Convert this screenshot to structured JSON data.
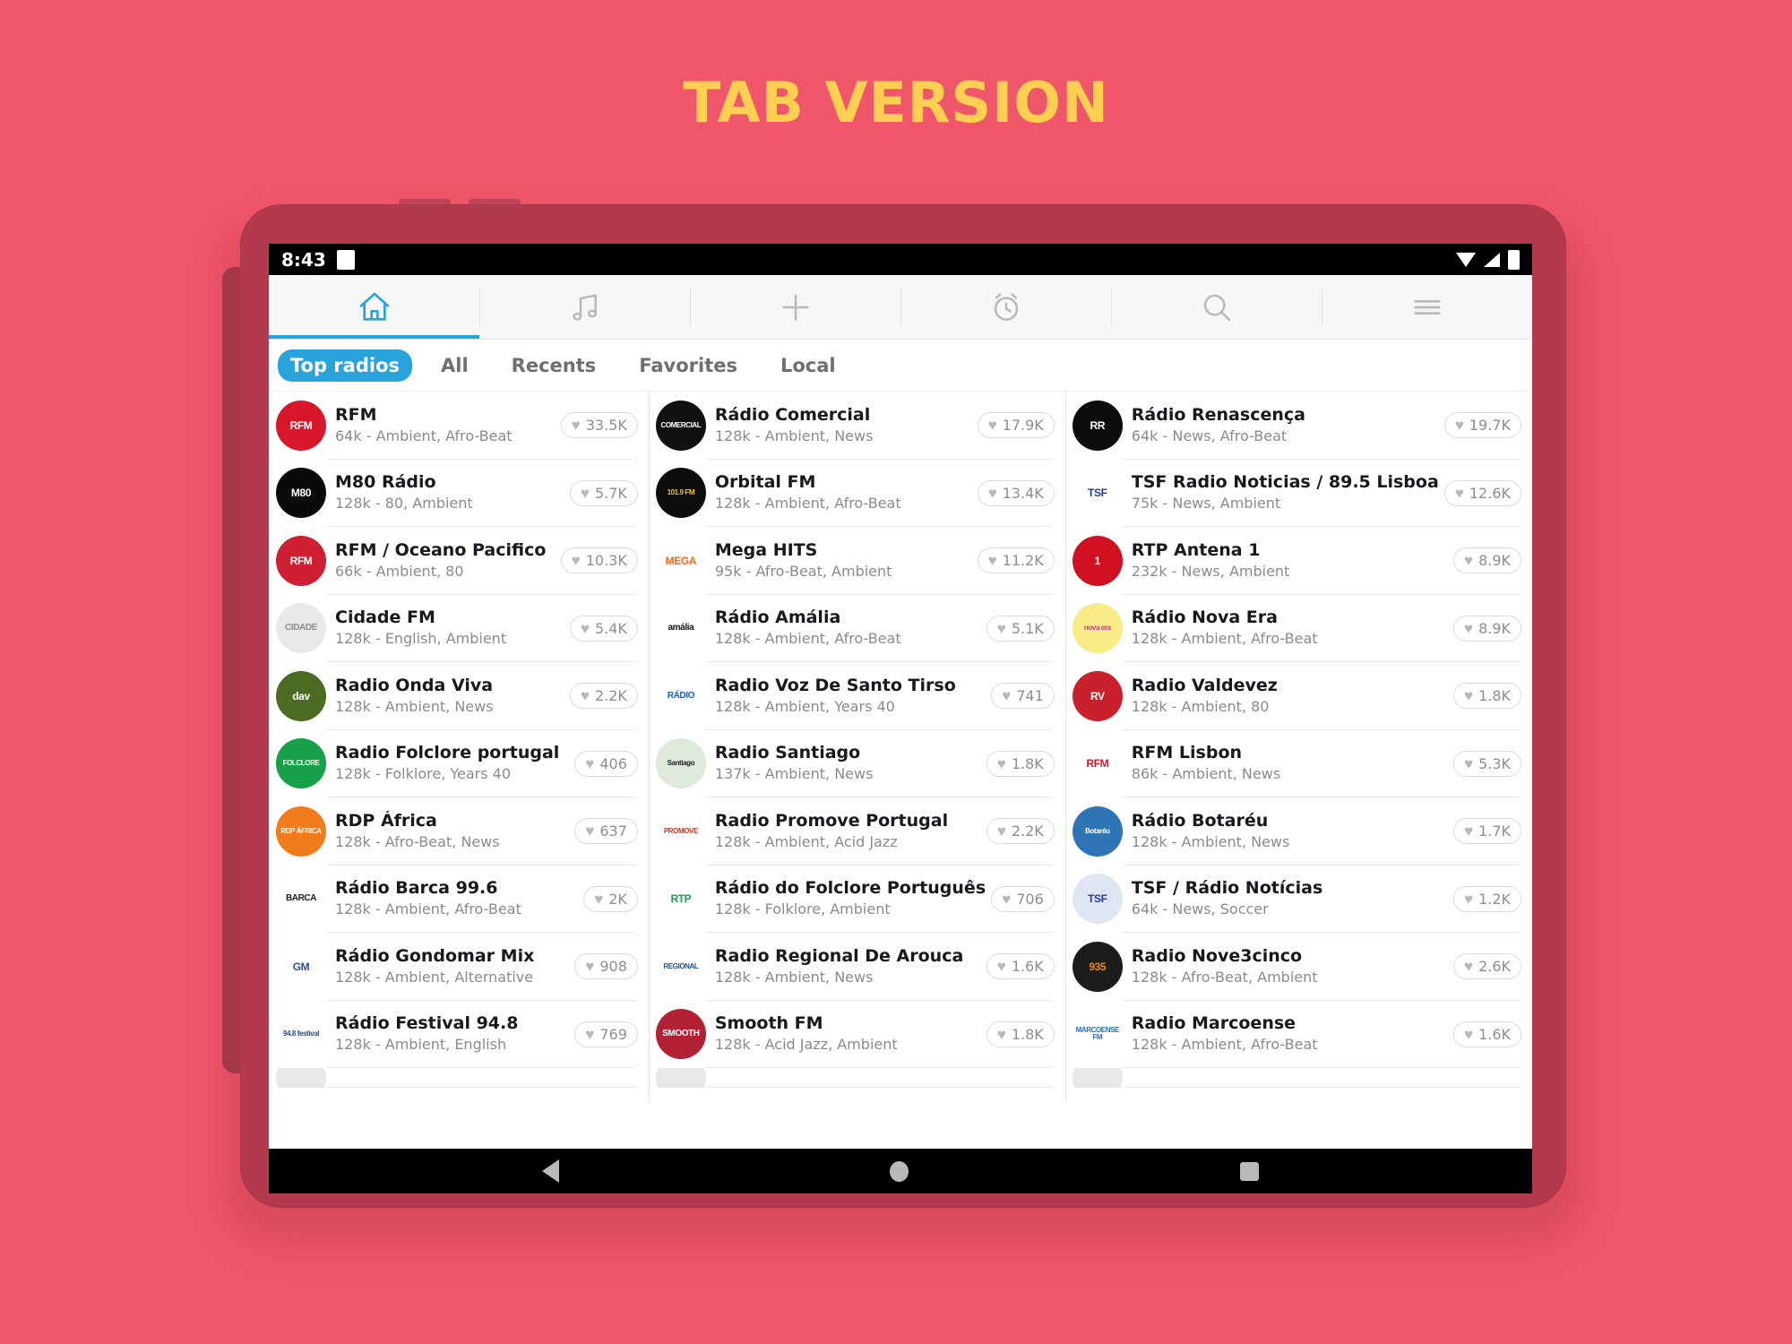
{
  "headline": "TAB VERSION",
  "status_bar": {
    "time": "8:43",
    "icons": [
      "notification-square",
      "wifi-icon",
      "signal-icon",
      "battery-icon"
    ]
  },
  "icon_tabs": [
    {
      "name": "home",
      "icon": "home-icon",
      "active": true
    },
    {
      "name": "music",
      "icon": "music-note-icon",
      "active": false
    },
    {
      "name": "add",
      "icon": "plus-icon",
      "active": false
    },
    {
      "name": "alarm",
      "icon": "alarm-clock-icon",
      "active": false
    },
    {
      "name": "search",
      "icon": "search-icon",
      "active": false
    },
    {
      "name": "menu",
      "icon": "hamburger-menu-icon",
      "active": false
    }
  ],
  "filters": [
    {
      "label": "Top radios",
      "selected": true
    },
    {
      "label": "All",
      "selected": false
    },
    {
      "label": "Recents",
      "selected": false
    },
    {
      "label": "Favorites",
      "selected": false
    },
    {
      "label": "Local",
      "selected": false
    }
  ],
  "accent_color": "#29a3dc",
  "brand_bg_color": "#f0566a",
  "headline_color": "#ffcf52",
  "columns": [
    {
      "stations": [
        {
          "name": "RFM",
          "meta": "64k - Ambient, Afro-Beat",
          "likes": "33.5K",
          "logo_text": "RFM",
          "logo_bg": "#d8182a",
          "logo_fg": "#ffffff"
        },
        {
          "name": "M80 Rádio",
          "meta": "128k - 80, Ambient",
          "likes": "5.7K",
          "logo_text": "M80",
          "logo_bg": "#0a0a0a",
          "logo_fg": "#ffffff"
        },
        {
          "name": "RFM / Oceano Pacifico",
          "meta": "66k - Ambient, 80",
          "likes": "10.3K",
          "logo_text": "RFM",
          "logo_bg": "#cf1f32",
          "logo_fg": "#ffffff"
        },
        {
          "name": "Cidade FM",
          "meta": "128k - English, Ambient",
          "likes": "5.4K",
          "logo_text": "CIDADE",
          "logo_bg": "#e9e9e9",
          "logo_fg": "#8d8d8d"
        },
        {
          "name": "Radio Onda Viva",
          "meta": "128k - Ambient, News",
          "likes": "2.2K",
          "logo_text": "dav",
          "logo_bg": "#4b6b23",
          "logo_fg": "#ffffff"
        },
        {
          "name": "Radio Folclore portugal",
          "meta": "128k - Folklore, Years 40",
          "likes": "406",
          "logo_text": "FOLCLORE",
          "logo_bg": "#17a24a",
          "logo_fg": "#ffffff"
        },
        {
          "name": "RDP África",
          "meta": "128k - Afro-Beat, News",
          "likes": "637",
          "logo_text": "RDP ÁFRICA",
          "logo_bg": "#f07c1b",
          "logo_fg": "#ffffff"
        },
        {
          "name": "Rádio Barca 99.6",
          "meta": "128k - Ambient, Afro-Beat",
          "likes": "2K",
          "logo_text": "BARCA",
          "logo_bg": "#ffffff",
          "logo_fg": "#1a1a1a"
        },
        {
          "name": "Rádio Gondomar Mix",
          "meta": "128k - Ambient, Alternative",
          "likes": "908",
          "logo_text": "GM",
          "logo_bg": "#ffffff",
          "logo_fg": "#2b4e8c"
        },
        {
          "name": "Rádio Festival 94.8",
          "meta": "128k - Ambient, English",
          "likes": "769",
          "logo_text": "94.8 festival",
          "logo_bg": "#ffffff",
          "logo_fg": "#1b4fa0"
        }
      ]
    },
    {
      "stations": [
        {
          "name": "Rádio Comercial",
          "meta": "128k - Ambient, News",
          "likes": "17.9K",
          "logo_text": "COMERCIAL",
          "logo_bg": "#111111",
          "logo_fg": "#ffffff"
        },
        {
          "name": "Orbital FM",
          "meta": "128k - Ambient, Afro-Beat",
          "likes": "13.4K",
          "logo_text": "101.9 FM",
          "logo_bg": "#0d0d0d",
          "logo_fg": "#f5c518"
        },
        {
          "name": "Mega HITS",
          "meta": "95k - Afro-Beat, Ambient",
          "likes": "11.2K",
          "logo_text": "MEGA",
          "logo_bg": "#ffffff",
          "logo_fg": "#f26a1b"
        },
        {
          "name": "Rádio Amália",
          "meta": "128k - Ambient, Afro-Beat",
          "likes": "5.1K",
          "logo_text": "amália",
          "logo_bg": "#ffffff",
          "logo_fg": "#111111"
        },
        {
          "name": "Radio Voz De Santo Tirso",
          "meta": "128k - Ambient, Years 40",
          "likes": "741",
          "logo_text": "RÁDIO",
          "logo_bg": "#ffffff",
          "logo_fg": "#1a5fb4"
        },
        {
          "name": "Radio Santiago",
          "meta": "137k - Ambient, News",
          "likes": "1.8K",
          "logo_text": "Santiago",
          "logo_bg": "#dfeadd",
          "logo_fg": "#1f1f1f"
        },
        {
          "name": "Radio Promove Portugal",
          "meta": "128k - Ambient, Acid Jazz",
          "likes": "2.2K",
          "logo_text": "PROMOVE",
          "logo_bg": "#ffffff",
          "logo_fg": "#c0392b"
        },
        {
          "name": "Rádio do Folclore Português",
          "meta": "128k - Folklore, Ambient",
          "likes": "706",
          "logo_text": "RTP",
          "logo_bg": "#ffffff",
          "logo_fg": "#17a24a"
        },
        {
          "name": "Radio Regional De Arouca",
          "meta": "128k - Ambient, News",
          "likes": "1.6K",
          "logo_text": "REGIONAL",
          "logo_bg": "#ffffff",
          "logo_fg": "#1f4e9c"
        },
        {
          "name": "Smooth FM",
          "meta": "128k - Acid Jazz, Ambient",
          "likes": "1.8K",
          "logo_text": "SMOOTH",
          "logo_bg": "#b22234",
          "logo_fg": "#ffffff"
        }
      ]
    },
    {
      "stations": [
        {
          "name": "Rádio Renascença",
          "meta": "64k - News, Afro-Beat",
          "likes": "19.7K",
          "logo_text": "RR",
          "logo_bg": "#0c0c0c",
          "logo_fg": "#ffffff"
        },
        {
          "name": "TSF Radio Noticias / 89.5 Lisboa",
          "meta": "75k - News, Ambient",
          "likes": "12.6K",
          "logo_text": "TSF",
          "logo_bg": "#ffffff",
          "logo_fg": "#2b3a8f"
        },
        {
          "name": "RTP Antena 1",
          "meta": "232k - News, Ambient",
          "likes": "8.9K",
          "logo_text": "1",
          "logo_bg": "#cf1020",
          "logo_fg": "#ffffff"
        },
        {
          "name": "Rádio Nova Era",
          "meta": "128k - Ambient, Afro-Beat",
          "likes": "8.9K",
          "logo_text": "nova era",
          "logo_bg": "#f7ec86",
          "logo_fg": "#e0308a"
        },
        {
          "name": "Radio Valdevez",
          "meta": "128k - Ambient, 80",
          "likes": "1.8K",
          "logo_text": "RV",
          "logo_bg": "#c8202c",
          "logo_fg": "#ffffff"
        },
        {
          "name": "RFM Lisbon",
          "meta": "86k - Ambient, News",
          "likes": "5.3K",
          "logo_text": "RFM",
          "logo_bg": "#ffffff",
          "logo_fg": "#d8182a"
        },
        {
          "name": "Rádio Botaréu",
          "meta": "128k - Ambient, News",
          "likes": "1.7K",
          "logo_text": "Botaréu",
          "logo_bg": "#2f74b5",
          "logo_fg": "#ffffff"
        },
        {
          "name": "TSF / Rádio Notícias",
          "meta": "64k - News, Soccer",
          "likes": "1.2K",
          "logo_text": "TSF",
          "logo_bg": "#dfe6f2",
          "logo_fg": "#2b3a8f"
        },
        {
          "name": "Radio Nove3cinco",
          "meta": "128k - Afro-Beat, Ambient",
          "likes": "2.6K",
          "logo_text": "935",
          "logo_bg": "#1c1c1c",
          "logo_fg": "#f08c1b"
        },
        {
          "name": "Radio Marcoense",
          "meta": "128k - Ambient, Afro-Beat",
          "likes": "1.6K",
          "logo_text": "MARCOENSE FM",
          "logo_bg": "#ffffff",
          "logo_fg": "#2a6fb5"
        }
      ]
    }
  ],
  "nav_bar": {
    "back": "back-triangle-icon",
    "home": "home-circle-icon",
    "recents": "recents-square-icon"
  }
}
